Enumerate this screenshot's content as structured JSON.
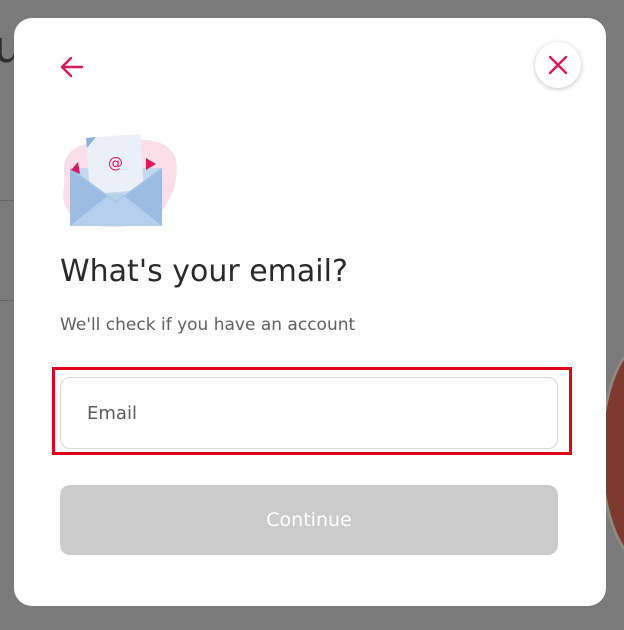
{
  "background": {
    "partial_text": "u"
  },
  "modal": {
    "back_icon": "arrow-left-icon",
    "close_icon": "close-x-icon",
    "illustration_icon": "envelope-at-icon",
    "title": "What's your email?",
    "subtitle": "We'll check if you have an account",
    "email_placeholder": "Email",
    "email_value": "",
    "continue_label": "Continue"
  },
  "colors": {
    "accent": "#d8195b",
    "button_disabled": "#cbcbcb",
    "highlight_border": "#e0001b"
  }
}
